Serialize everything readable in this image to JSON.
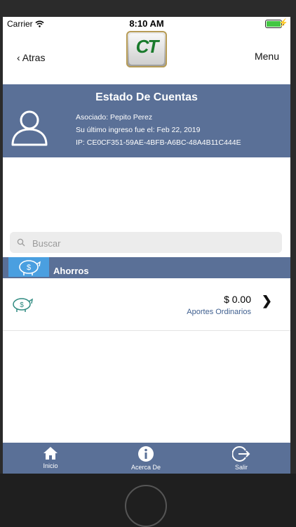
{
  "status": {
    "carrier": "Carrier",
    "time": "8:10 AM"
  },
  "nav": {
    "back_label": "Atras",
    "menu_label": "Menu",
    "logo_text": "CT"
  },
  "header": {
    "title": "Estado De Cuentas",
    "associate": "Asociado: Pepito Perez",
    "last_login": "Su último ingreso fue el: Feb 22, 2019",
    "ip": "IP: CE0CF351-59AE-4BFB-A6BC-48A4B11C444E"
  },
  "search": {
    "placeholder": "Buscar"
  },
  "section": {
    "title": "Ahorros"
  },
  "account": {
    "amount": "$ 0.00",
    "name": "Aportes Ordinarios"
  },
  "tabs": [
    {
      "label": "Inicio",
      "icon": "home-icon"
    },
    {
      "label": "Acerca De",
      "icon": "info-icon"
    },
    {
      "label": "Salir",
      "icon": "logout-icon"
    }
  ],
  "colors": {
    "header_bg": "#5a7097",
    "section_badge": "#4a9fe0",
    "link_text": "#3f5f8f"
  }
}
